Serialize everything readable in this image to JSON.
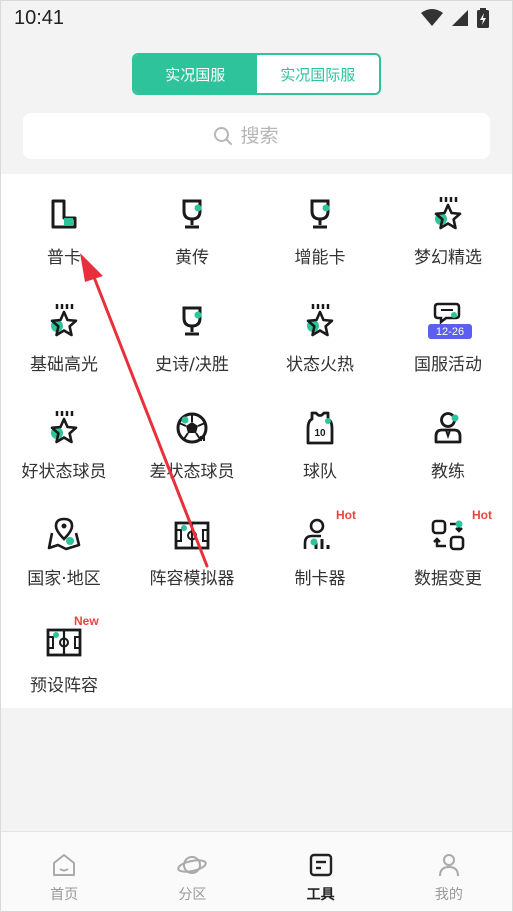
{
  "status_bar": {
    "time": "10:41"
  },
  "segmented": {
    "tabs": [
      {
        "label": "实况国服",
        "active": true
      },
      {
        "label": "实况国际服",
        "active": false
      }
    ]
  },
  "search": {
    "placeholder": "搜索",
    "icon": "search-icon"
  },
  "tools": [
    {
      "label": "普卡",
      "icon": "boot-icon"
    },
    {
      "label": "黄传",
      "icon": "trophy-icon"
    },
    {
      "label": "增能卡",
      "icon": "trophy-icon"
    },
    {
      "label": "梦幻精选",
      "icon": "star-icon"
    },
    {
      "label": "基础高光",
      "icon": "star-icon"
    },
    {
      "label": "史诗/决胜",
      "icon": "trophy-icon"
    },
    {
      "label": "状态火热",
      "icon": "star-icon"
    },
    {
      "label": "国服活动",
      "icon": "chat-icon",
      "date_badge": "12-26"
    },
    {
      "label": "好状态球员",
      "icon": "star-icon"
    },
    {
      "label": "差状态球员",
      "icon": "ball-icon"
    },
    {
      "label": "球队",
      "icon": "jersey-icon"
    },
    {
      "label": "教练",
      "icon": "coach-icon"
    },
    {
      "label": "国家·地区",
      "icon": "map-icon"
    },
    {
      "label": "阵容模拟器",
      "icon": "pitch-icon"
    },
    {
      "label": "制卡器",
      "icon": "card-maker-icon",
      "badge": "Hot"
    },
    {
      "label": "数据变更",
      "icon": "swap-icon",
      "badge": "Hot"
    },
    {
      "label": "预设阵容",
      "icon": "pitch-icon",
      "badge": "New"
    }
  ],
  "bottom_nav": [
    {
      "label": "首页",
      "icon": "home-icon",
      "active": false
    },
    {
      "label": "分区",
      "icon": "planet-icon",
      "active": false
    },
    {
      "label": "工具",
      "icon": "tools-icon",
      "active": true
    },
    {
      "label": "我的",
      "icon": "user-icon",
      "active": false
    }
  ],
  "colors": {
    "accent": "#2ec39a",
    "badge": "#e8463d",
    "date_badge": "#5b5ef0"
  }
}
